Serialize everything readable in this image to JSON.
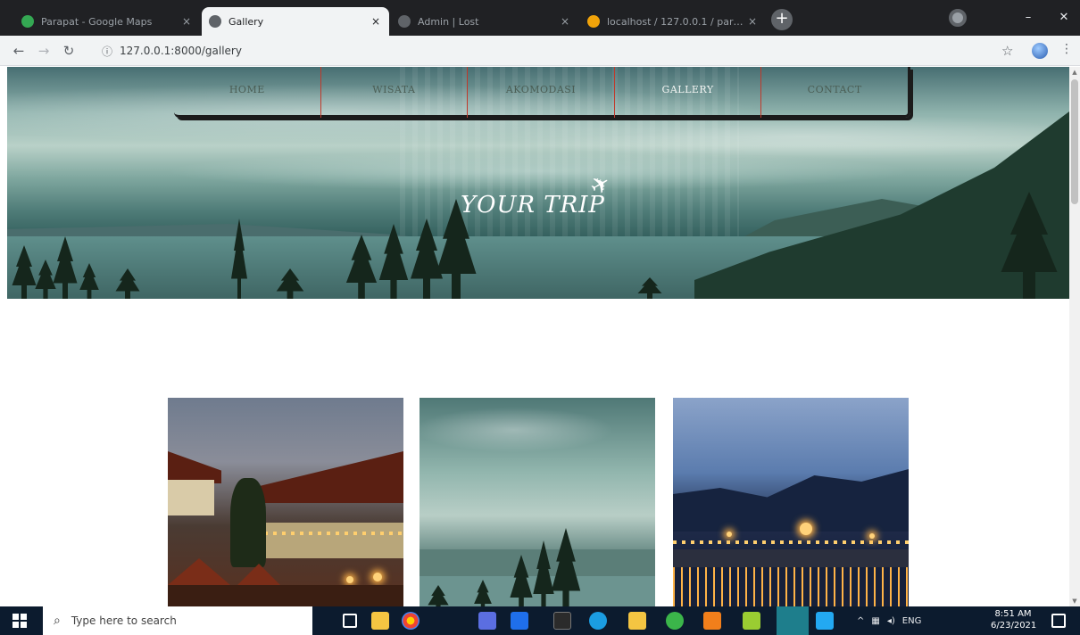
{
  "browser": {
    "tabs": [
      {
        "title": "Parapat - Google Maps",
        "favicon_color": "#34a853",
        "active": false
      },
      {
        "title": "Gallery",
        "favicon_color": "#5f6368",
        "active": true
      },
      {
        "title": "Admin | Lost",
        "favicon_color": "#5f6368",
        "active": false
      },
      {
        "title": "localhost / 127.0.0.1 / parapat",
        "favicon_color": "#f0a30a",
        "active": false
      }
    ],
    "close_glyph": "×",
    "new_tab_glyph": "+",
    "url": "127.0.0.1:8000/gallery",
    "window_buttons": {
      "minimize": "–",
      "close": "✕"
    }
  },
  "site": {
    "nav": [
      {
        "label": "HOME",
        "active": false
      },
      {
        "label": "WISATA",
        "active": false
      },
      {
        "label": "AKOMODASI",
        "active": false
      },
      {
        "label": "GALLERY",
        "active": true
      },
      {
        "label": "CONTACT",
        "active": false
      }
    ],
    "brand": "YOUR TRIP",
    "gallery": [
      {
        "alt": "hotel",
        "icon": "hotel-photo"
      },
      {
        "alt": "lake",
        "icon": "lake-photo"
      },
      {
        "alt": "night",
        "icon": "night-lake-photo"
      }
    ]
  },
  "taskbar": {
    "search_placeholder": "Type here to search",
    "tray_lang": "ENG",
    "time": "8:51 AM",
    "date": "6/23/2021"
  },
  "colors": {
    "nav_divider": "#c0392b",
    "taskbar_bg": "#0c1b2e",
    "tab_strip_bg": "#202124"
  }
}
